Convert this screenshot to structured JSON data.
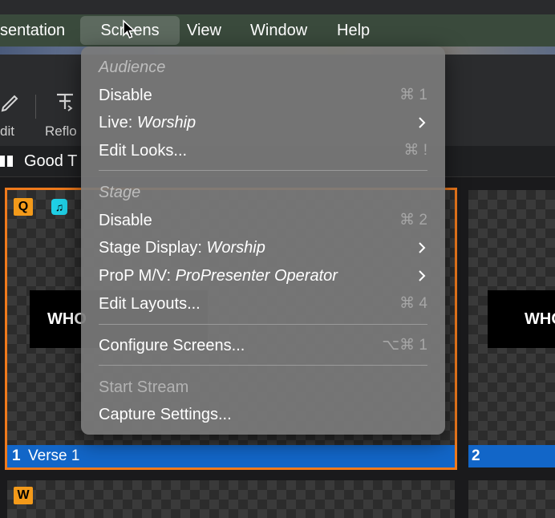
{
  "menubar": {
    "items": [
      {
        "label": "sentation"
      },
      {
        "label": "Screens"
      },
      {
        "label": "View"
      },
      {
        "label": "Window"
      },
      {
        "label": "Help"
      }
    ],
    "active_index": 1
  },
  "toolbar": {
    "edit_label": "dit",
    "reflow_label": "Reflo"
  },
  "group_title": "Good T",
  "slides": [
    {
      "number": "1",
      "label": "Verse 1",
      "badge": "Q",
      "screen_text": "WHO"
    },
    {
      "number": "2",
      "label": "",
      "screen_text": "WHO"
    },
    {
      "badge": "W"
    }
  ],
  "menu": {
    "audience_header": "Audience",
    "audience_disable": "Disable",
    "audience_disable_shortcut": "⌘ 1",
    "live_prefix": "Live: ",
    "live_value": "Worship",
    "edit_looks": "Edit Looks...",
    "edit_looks_shortcut": "⌘ !",
    "stage_header": "Stage",
    "stage_disable": "Disable",
    "stage_disable_shortcut": "⌘ 2",
    "stage_display_prefix": "Stage Display: ",
    "stage_display_value": "Worship",
    "propmv_prefix": "ProP M/V: ",
    "propmv_value": "ProPresenter Operator",
    "edit_layouts": "Edit Layouts...",
    "edit_layouts_shortcut": "⌘ 4",
    "configure_screens": "Configure Screens...",
    "configure_screens_shortcut": "⌥⌘ 1",
    "start_stream": "Start Stream",
    "capture_settings": "Capture Settings..."
  },
  "colors": {
    "menu_background": "#7a7a7a",
    "selection_outline": "#f07a1c",
    "slide_label_bar": "#1266c8",
    "badge_q": "#f39a1a",
    "badge_music": "#1fd0e6"
  }
}
